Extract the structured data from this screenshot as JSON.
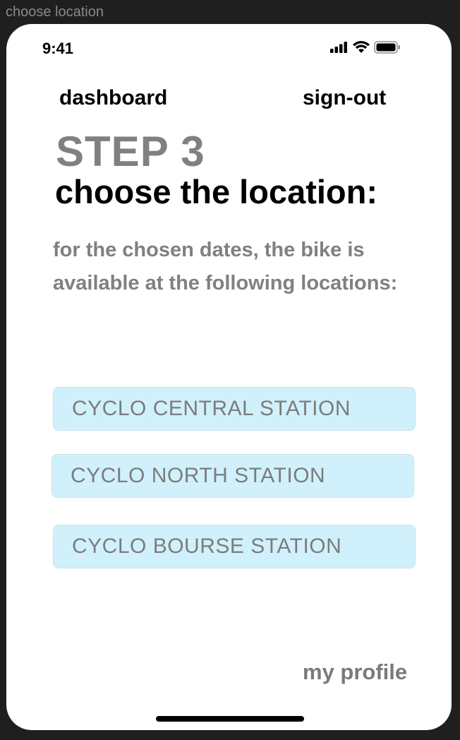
{
  "window": {
    "title": "choose location"
  },
  "status_bar": {
    "time": "9:41",
    "icons": [
      "signal-icon",
      "wifi-icon",
      "battery-icon"
    ]
  },
  "nav": {
    "dashboard_label": "dashboard",
    "signout_label": "sign-out"
  },
  "main": {
    "step_label": "STEP 3",
    "heading": "choose the location:",
    "description": "for the chosen dates, the bike is available at the following locations:",
    "locations": [
      {
        "label": "CYCLO CENTRAL STATION"
      },
      {
        "label": "CYCLO NORTH STATION"
      },
      {
        "label": "CYCLO BOURSE STATION"
      }
    ]
  },
  "footer": {
    "profile_label": "my profile"
  },
  "colors": {
    "location_bg": "#d0f1fc",
    "muted_text": "#808080",
    "frame_bg": "#1f1f1f"
  }
}
